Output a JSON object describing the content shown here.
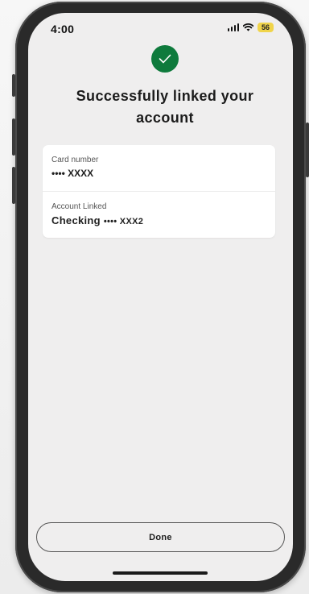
{
  "status_bar": {
    "time": "4:00",
    "battery": "56",
    "signal_icon": "signal-bars-icon",
    "wifi_icon": "wifi-icon"
  },
  "header": {
    "icon": "checkmark-icon",
    "title": "Successfully linked your account",
    "accent_color": "#0e7a3c"
  },
  "card": {
    "card_number_label": "Card number",
    "card_number_value": "•••• XXXX",
    "account_label": "Account Linked",
    "account_type": "Checking",
    "account_value": "•••• XXX2"
  },
  "actions": {
    "done_label": "Done"
  }
}
